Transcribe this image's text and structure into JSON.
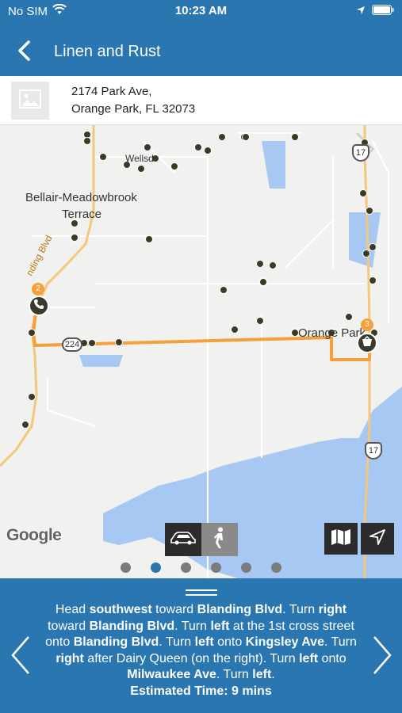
{
  "status_bar": {
    "carrier": "No SIM",
    "time": "10:23 AM"
  },
  "nav": {
    "title": "Linen and Rust",
    "back_icon": "chevron-left-icon"
  },
  "address": {
    "line1": "2174 Park Ave,",
    "line2": "Orange Park, FL 32073"
  },
  "map": {
    "labels": {
      "bellair_1": "Bellair-Meadowbrook",
      "bellair_2": "Terrace",
      "wells": "Wellsd",
      "blanding": "nding Blvd",
      "orange_park": "Orange Park",
      "shield_17_top": "17",
      "shield_17_bottom": "17",
      "shield_224": "224",
      "marker_start": "2",
      "marker_end": "3"
    },
    "attribution": "Google",
    "route_color": "#f5a03a",
    "page_count": 6,
    "active_page": 2
  },
  "directions": {
    "segments": [
      {
        "t": "Head "
      },
      {
        "b": "southwest"
      },
      {
        "t": " toward "
      },
      {
        "b": "Blanding Blvd"
      },
      {
        "t": ". Turn "
      },
      {
        "b": "right"
      },
      {
        "t": " toward "
      },
      {
        "b": "Blanding Blvd"
      },
      {
        "t": ". Turn "
      },
      {
        "b": "left"
      },
      {
        "t": " at the 1st cross street onto "
      },
      {
        "b": "Blanding Blvd"
      },
      {
        "t": ". Turn "
      },
      {
        "b": "left"
      },
      {
        "t": " onto "
      },
      {
        "b": "Kingsley Ave"
      },
      {
        "t": ". Turn "
      },
      {
        "b": "right"
      },
      {
        "t": " after Dairy Queen (on the right). Turn "
      },
      {
        "b": "left"
      },
      {
        "t": " onto "
      },
      {
        "b": "Milwaukee Ave"
      },
      {
        "t": ". Turn "
      },
      {
        "b": "left"
      },
      {
        "t": "."
      }
    ],
    "estimated_time": "Estimated Time: 9 mins"
  }
}
